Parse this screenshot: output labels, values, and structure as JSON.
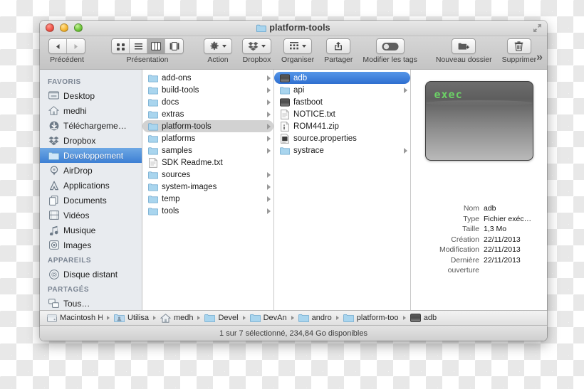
{
  "window": {
    "title": "platform-tools",
    "title_icon": "folder-icon",
    "traffic_lights": [
      "close-button",
      "minimize-button",
      "zoom-button"
    ],
    "fullscreen_icon": "fullscreen-icon"
  },
  "toolbar": {
    "back_forward": {
      "label": "Précédent",
      "back_icon": "back-arrow-icon",
      "forward_icon": "forward-arrow-icon"
    },
    "view": {
      "label": "Présentation",
      "modes": [
        {
          "name": "icon-view",
          "icon": "grid-icon",
          "active": false
        },
        {
          "name": "list-view",
          "icon": "list-icon",
          "active": false
        },
        {
          "name": "column-view",
          "icon": "columns-icon",
          "active": true
        },
        {
          "name": "coverflow-view",
          "icon": "coverflow-icon",
          "active": false
        }
      ]
    },
    "action": {
      "label": "Action",
      "icon": "gear-icon"
    },
    "dropbox": {
      "label": "Dropbox",
      "icon": "dropbox-icon"
    },
    "arrange": {
      "label": "Organiser",
      "icon": "arrange-icon"
    },
    "share": {
      "label": "Partager",
      "icon": "share-icon"
    },
    "tags": {
      "label": "Modifier les tags",
      "icon": "tag-toggle-icon"
    },
    "new_folder": {
      "label": "Nouveau dossier",
      "icon": "new-folder-icon"
    },
    "delete": {
      "label": "Supprimer",
      "icon": "trash-icon"
    },
    "overflow": {
      "icon": "chevron-double-right-icon",
      "glyph": "»"
    }
  },
  "sidebar": {
    "sections": [
      {
        "header": "FAVORIS",
        "items": [
          {
            "label": "Desktop",
            "icon": "desktop-icon",
            "selected": false
          },
          {
            "label": "medhi",
            "icon": "home-icon",
            "selected": false
          },
          {
            "label": "Téléchargeme…",
            "icon": "downloads-icon",
            "selected": false
          },
          {
            "label": "Dropbox",
            "icon": "dropbox-icon",
            "selected": false
          },
          {
            "label": "Developpement",
            "icon": "folder-icon",
            "selected": true
          },
          {
            "label": "AirDrop",
            "icon": "airdrop-icon",
            "selected": false
          },
          {
            "label": "Applications",
            "icon": "applications-icon",
            "selected": false
          },
          {
            "label": "Documents",
            "icon": "documents-icon",
            "selected": false
          },
          {
            "label": "Vidéos",
            "icon": "movies-icon",
            "selected": false
          },
          {
            "label": "Musique",
            "icon": "music-icon",
            "selected": false
          },
          {
            "label": "Images",
            "icon": "pictures-icon",
            "selected": false
          }
        ]
      },
      {
        "header": "APPAREILS",
        "items": [
          {
            "label": "Disque distant",
            "icon": "remote-disc-icon",
            "selected": false
          }
        ]
      },
      {
        "header": "PARTAGÉS",
        "items": [
          {
            "label": "Tous…",
            "icon": "network-icon",
            "selected": false
          }
        ]
      }
    ]
  },
  "columns": [
    {
      "name": "column-android-sdk",
      "rows": [
        {
          "label": "add-ons",
          "icon": "folder-icon",
          "disclosure": true,
          "state": "none"
        },
        {
          "label": "build-tools",
          "icon": "folder-icon",
          "disclosure": true,
          "state": "none"
        },
        {
          "label": "docs",
          "icon": "folder-icon",
          "disclosure": true,
          "state": "none"
        },
        {
          "label": "extras",
          "icon": "folder-icon",
          "disclosure": true,
          "state": "none"
        },
        {
          "label": "platform-tools",
          "icon": "folder-icon",
          "disclosure": true,
          "state": "selected-inactive"
        },
        {
          "label": "platforms",
          "icon": "folder-icon",
          "disclosure": true,
          "state": "none"
        },
        {
          "label": "samples",
          "icon": "folder-icon",
          "disclosure": true,
          "state": "none"
        },
        {
          "label": "SDK Readme.txt",
          "icon": "text-document-icon",
          "disclosure": false,
          "state": "none"
        },
        {
          "label": "sources",
          "icon": "folder-icon",
          "disclosure": true,
          "state": "none"
        },
        {
          "label": "system-images",
          "icon": "folder-icon",
          "disclosure": true,
          "state": "none"
        },
        {
          "label": "temp",
          "icon": "folder-icon",
          "disclosure": true,
          "state": "none"
        },
        {
          "label": "tools",
          "icon": "folder-icon",
          "disclosure": true,
          "state": "none"
        }
      ]
    },
    {
      "name": "column-platform-tools",
      "rows": [
        {
          "label": "adb",
          "icon": "unix-executable-icon",
          "disclosure": false,
          "state": "selected-active"
        },
        {
          "label": "api",
          "icon": "folder-icon",
          "disclosure": true,
          "state": "none"
        },
        {
          "label": "fastboot",
          "icon": "unix-executable-icon",
          "disclosure": false,
          "state": "none"
        },
        {
          "label": "NOTICE.txt",
          "icon": "text-document-icon",
          "disclosure": false,
          "state": "none"
        },
        {
          "label": "ROM441.zip",
          "icon": "archive-icon",
          "disclosure": false,
          "state": "none"
        },
        {
          "label": "source.properties",
          "icon": "properties-file-icon",
          "disclosure": false,
          "state": "none"
        },
        {
          "label": "systrace",
          "icon": "folder-icon",
          "disclosure": true,
          "state": "none"
        }
      ]
    }
  ],
  "preview": {
    "icon_name": "unix-executable-preview-icon",
    "icon_text": "exec",
    "icon_text_color": "#6cd166",
    "metadata": [
      {
        "key": "Nom",
        "value": "adb"
      },
      {
        "key": "Type",
        "value": "Fichier exéc…"
      },
      {
        "key": "Taille",
        "value": "1,3 Mo"
      },
      {
        "key": "Création",
        "value": "22/11/2013"
      },
      {
        "key": "Modification",
        "value": "22/11/2013"
      },
      {
        "key": "Dernière ouverture",
        "value": "22/11/2013"
      }
    ]
  },
  "pathbar": {
    "crumbs": [
      {
        "label": "Macintosh HD",
        "icon": "hard-disk-icon"
      },
      {
        "label": "Utilisa",
        "icon": "users-folder-icon"
      },
      {
        "label": "medh",
        "icon": "home-icon"
      },
      {
        "label": "Devel",
        "icon": "folder-icon"
      },
      {
        "label": "DevAn",
        "icon": "folder-icon"
      },
      {
        "label": "andro",
        "icon": "folder-icon"
      },
      {
        "label": "platform-tools",
        "icon": "folder-icon"
      },
      {
        "label": "adb",
        "icon": "unix-executable-icon"
      }
    ]
  },
  "statusbar": {
    "text": "1 sur 7 sélectionné, 234,84 Go disponibles"
  }
}
